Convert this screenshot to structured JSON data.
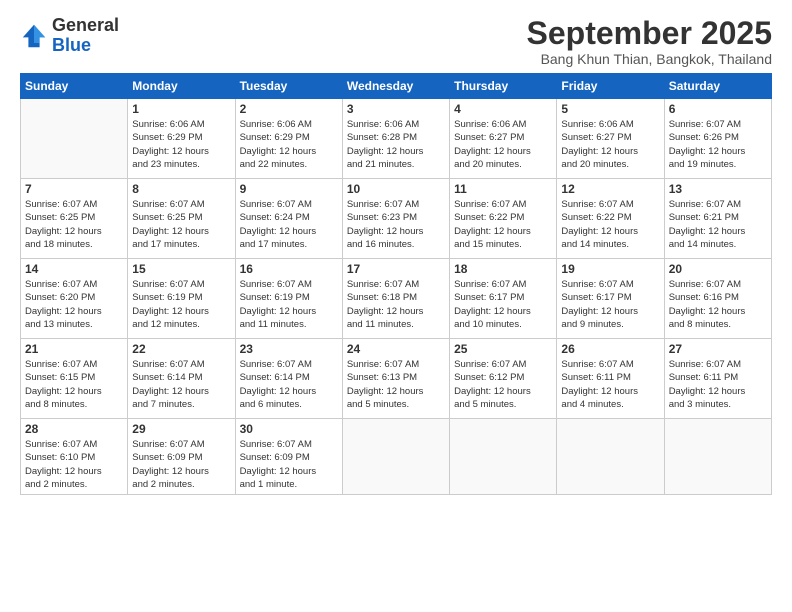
{
  "logo": {
    "general": "General",
    "blue": "Blue"
  },
  "title": "September 2025",
  "location": "Bang Khun Thian, Bangkok, Thailand",
  "header_days": [
    "Sunday",
    "Monday",
    "Tuesday",
    "Wednesday",
    "Thursday",
    "Friday",
    "Saturday"
  ],
  "weeks": [
    [
      {
        "day": "",
        "info": ""
      },
      {
        "day": "1",
        "info": "Sunrise: 6:06 AM\nSunset: 6:29 PM\nDaylight: 12 hours\nand 23 minutes."
      },
      {
        "day": "2",
        "info": "Sunrise: 6:06 AM\nSunset: 6:29 PM\nDaylight: 12 hours\nand 22 minutes."
      },
      {
        "day": "3",
        "info": "Sunrise: 6:06 AM\nSunset: 6:28 PM\nDaylight: 12 hours\nand 21 minutes."
      },
      {
        "day": "4",
        "info": "Sunrise: 6:06 AM\nSunset: 6:27 PM\nDaylight: 12 hours\nand 20 minutes."
      },
      {
        "day": "5",
        "info": "Sunrise: 6:06 AM\nSunset: 6:27 PM\nDaylight: 12 hours\nand 20 minutes."
      },
      {
        "day": "6",
        "info": "Sunrise: 6:07 AM\nSunset: 6:26 PM\nDaylight: 12 hours\nand 19 minutes."
      }
    ],
    [
      {
        "day": "7",
        "info": "Sunrise: 6:07 AM\nSunset: 6:25 PM\nDaylight: 12 hours\nand 18 minutes."
      },
      {
        "day": "8",
        "info": "Sunrise: 6:07 AM\nSunset: 6:25 PM\nDaylight: 12 hours\nand 17 minutes."
      },
      {
        "day": "9",
        "info": "Sunrise: 6:07 AM\nSunset: 6:24 PM\nDaylight: 12 hours\nand 17 minutes."
      },
      {
        "day": "10",
        "info": "Sunrise: 6:07 AM\nSunset: 6:23 PM\nDaylight: 12 hours\nand 16 minutes."
      },
      {
        "day": "11",
        "info": "Sunrise: 6:07 AM\nSunset: 6:22 PM\nDaylight: 12 hours\nand 15 minutes."
      },
      {
        "day": "12",
        "info": "Sunrise: 6:07 AM\nSunset: 6:22 PM\nDaylight: 12 hours\nand 14 minutes."
      },
      {
        "day": "13",
        "info": "Sunrise: 6:07 AM\nSunset: 6:21 PM\nDaylight: 12 hours\nand 14 minutes."
      }
    ],
    [
      {
        "day": "14",
        "info": "Sunrise: 6:07 AM\nSunset: 6:20 PM\nDaylight: 12 hours\nand 13 minutes."
      },
      {
        "day": "15",
        "info": "Sunrise: 6:07 AM\nSunset: 6:19 PM\nDaylight: 12 hours\nand 12 minutes."
      },
      {
        "day": "16",
        "info": "Sunrise: 6:07 AM\nSunset: 6:19 PM\nDaylight: 12 hours\nand 11 minutes."
      },
      {
        "day": "17",
        "info": "Sunrise: 6:07 AM\nSunset: 6:18 PM\nDaylight: 12 hours\nand 11 minutes."
      },
      {
        "day": "18",
        "info": "Sunrise: 6:07 AM\nSunset: 6:17 PM\nDaylight: 12 hours\nand 10 minutes."
      },
      {
        "day": "19",
        "info": "Sunrise: 6:07 AM\nSunset: 6:17 PM\nDaylight: 12 hours\nand 9 minutes."
      },
      {
        "day": "20",
        "info": "Sunrise: 6:07 AM\nSunset: 6:16 PM\nDaylight: 12 hours\nand 8 minutes."
      }
    ],
    [
      {
        "day": "21",
        "info": "Sunrise: 6:07 AM\nSunset: 6:15 PM\nDaylight: 12 hours\nand 8 minutes."
      },
      {
        "day": "22",
        "info": "Sunrise: 6:07 AM\nSunset: 6:14 PM\nDaylight: 12 hours\nand 7 minutes."
      },
      {
        "day": "23",
        "info": "Sunrise: 6:07 AM\nSunset: 6:14 PM\nDaylight: 12 hours\nand 6 minutes."
      },
      {
        "day": "24",
        "info": "Sunrise: 6:07 AM\nSunset: 6:13 PM\nDaylight: 12 hours\nand 5 minutes."
      },
      {
        "day": "25",
        "info": "Sunrise: 6:07 AM\nSunset: 6:12 PM\nDaylight: 12 hours\nand 5 minutes."
      },
      {
        "day": "26",
        "info": "Sunrise: 6:07 AM\nSunset: 6:11 PM\nDaylight: 12 hours\nand 4 minutes."
      },
      {
        "day": "27",
        "info": "Sunrise: 6:07 AM\nSunset: 6:11 PM\nDaylight: 12 hours\nand 3 minutes."
      }
    ],
    [
      {
        "day": "28",
        "info": "Sunrise: 6:07 AM\nSunset: 6:10 PM\nDaylight: 12 hours\nand 2 minutes."
      },
      {
        "day": "29",
        "info": "Sunrise: 6:07 AM\nSunset: 6:09 PM\nDaylight: 12 hours\nand 2 minutes."
      },
      {
        "day": "30",
        "info": "Sunrise: 6:07 AM\nSunset: 6:09 PM\nDaylight: 12 hours\nand 1 minute."
      },
      {
        "day": "",
        "info": ""
      },
      {
        "day": "",
        "info": ""
      },
      {
        "day": "",
        "info": ""
      },
      {
        "day": "",
        "info": ""
      }
    ]
  ]
}
